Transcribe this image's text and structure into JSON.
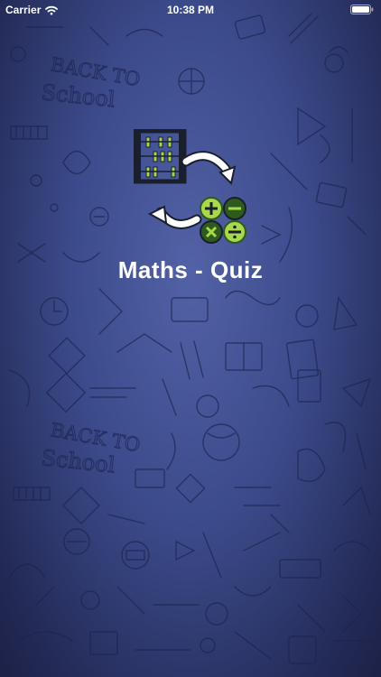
{
  "status_bar": {
    "carrier": "Carrier",
    "time": "10:38 PM",
    "wifi_icon": "wifi-icon",
    "battery_icon": "battery-full-icon"
  },
  "splash": {
    "title": "Maths - Quiz",
    "logo_icons": [
      "abacus-icon",
      "refresh-arrows-icon",
      "plus-icon",
      "minus-icon",
      "multiply-icon",
      "divide-icon"
    ]
  },
  "background": {
    "watermark_text": "BACK TO School",
    "colors": {
      "center": "#5262a6",
      "edge": "#1c2147",
      "accent_green": "#a8d94a",
      "dark_green": "#2f5a1d"
    }
  }
}
